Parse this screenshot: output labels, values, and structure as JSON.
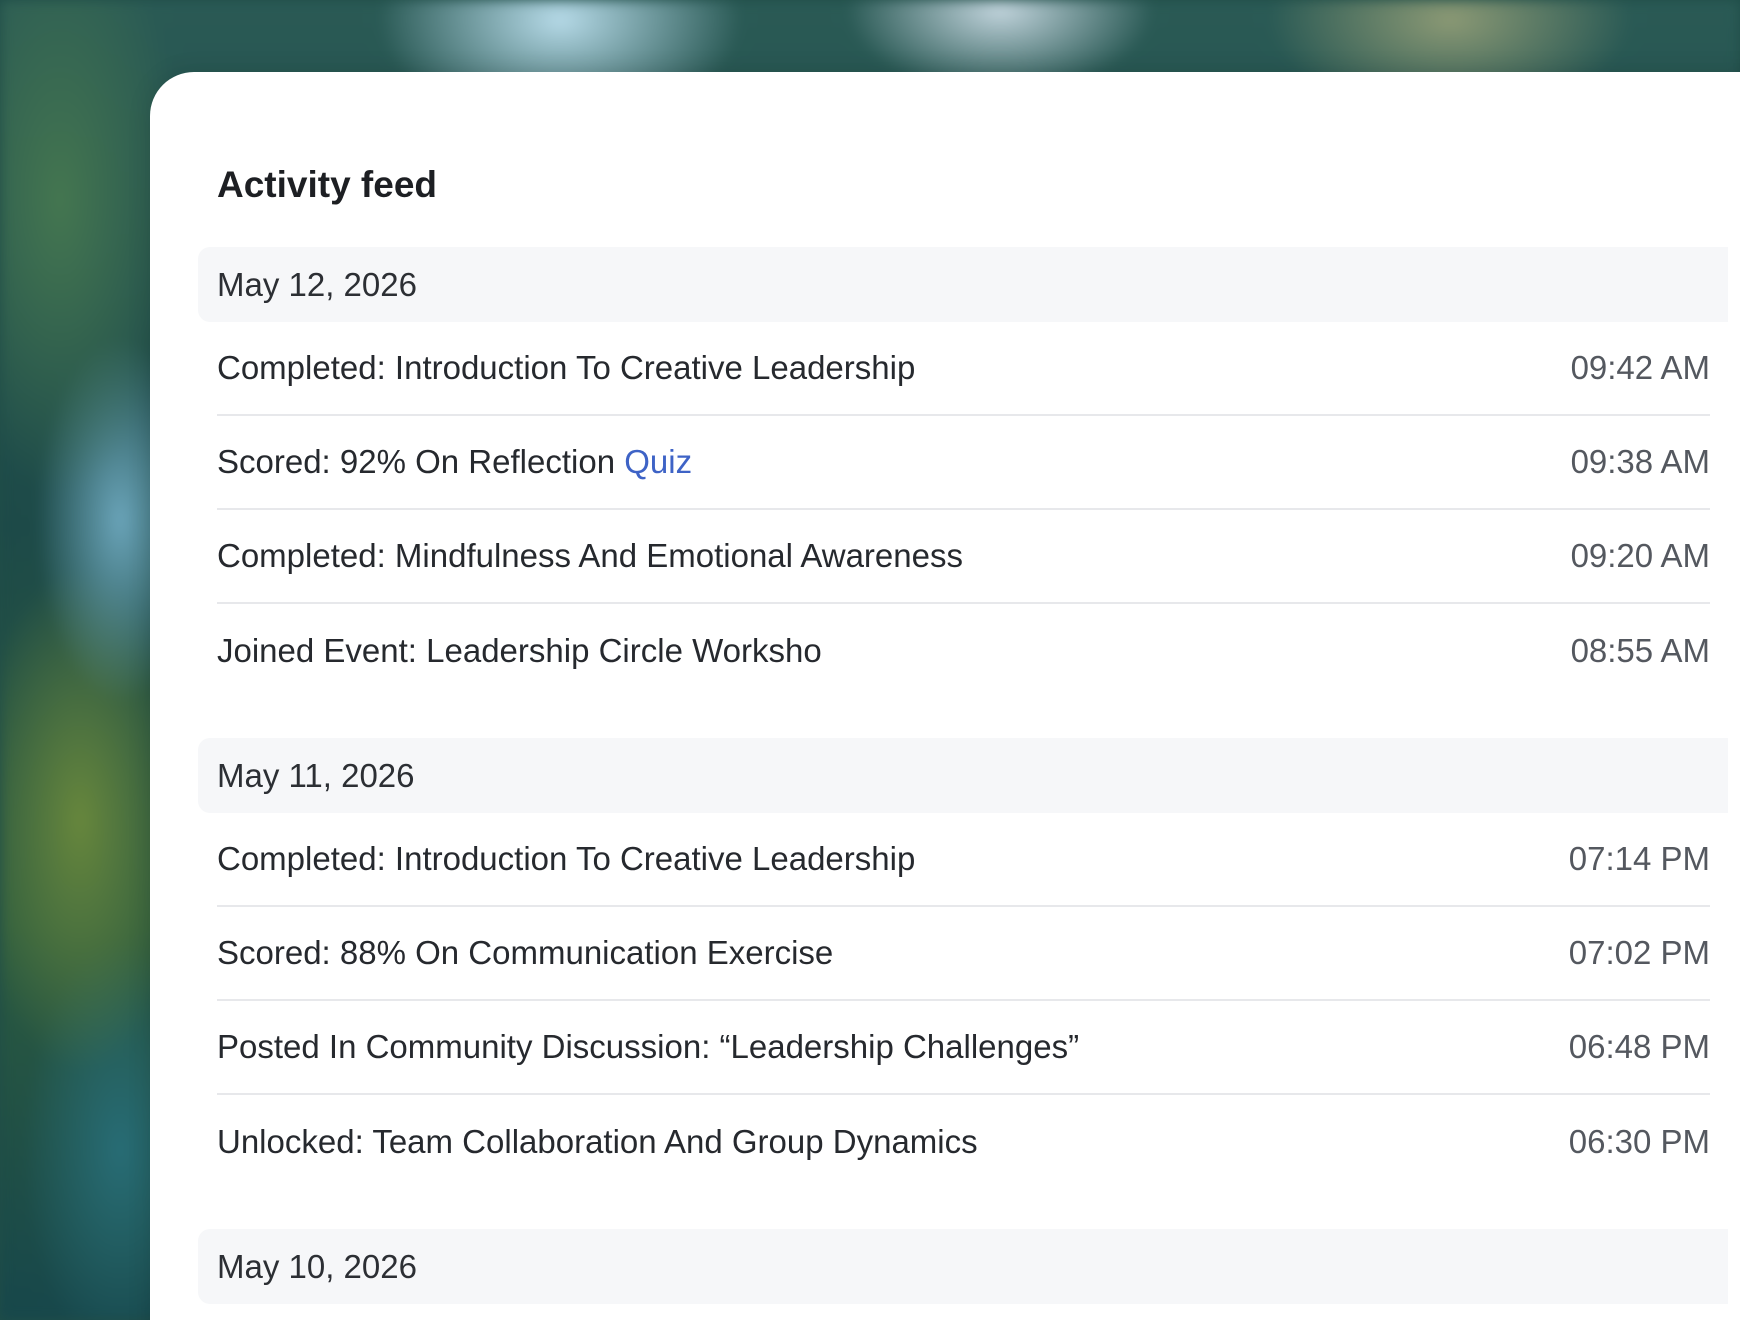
{
  "title": "Activity feed",
  "groups": [
    {
      "date": "May 12, 2026",
      "items": [
        {
          "text": "Completed: Introduction To Creative Leadership",
          "link": "",
          "time": "09:42 AM"
        },
        {
          "text": "Scored: 92% On Reflection ",
          "link": "Quiz",
          "time": "09:38 AM"
        },
        {
          "text": "Completed: Mindfulness And Emotional Awareness",
          "link": "",
          "time": "09:20 AM"
        },
        {
          "text": "Joined Event: Leadership Circle Worksho",
          "link": "",
          "time": "08:55 AM"
        }
      ]
    },
    {
      "date": "May 11, 2026",
      "items": [
        {
          "text": "Completed: Introduction To Creative Leadership",
          "link": "",
          "time": "07:14 PM"
        },
        {
          "text": "Scored: 88% On Communication Exercise",
          "link": "",
          "time": "07:02 PM"
        },
        {
          "text": "Posted In Community Discussion: “Leadership Challenges”",
          "link": "",
          "time": "06:48 PM"
        },
        {
          "text": "Unlocked: Team Collaboration And Group Dynamics",
          "link": "",
          "time": "06:30 PM"
        }
      ]
    },
    {
      "date": "May 10, 2026",
      "items": []
    }
  ]
}
